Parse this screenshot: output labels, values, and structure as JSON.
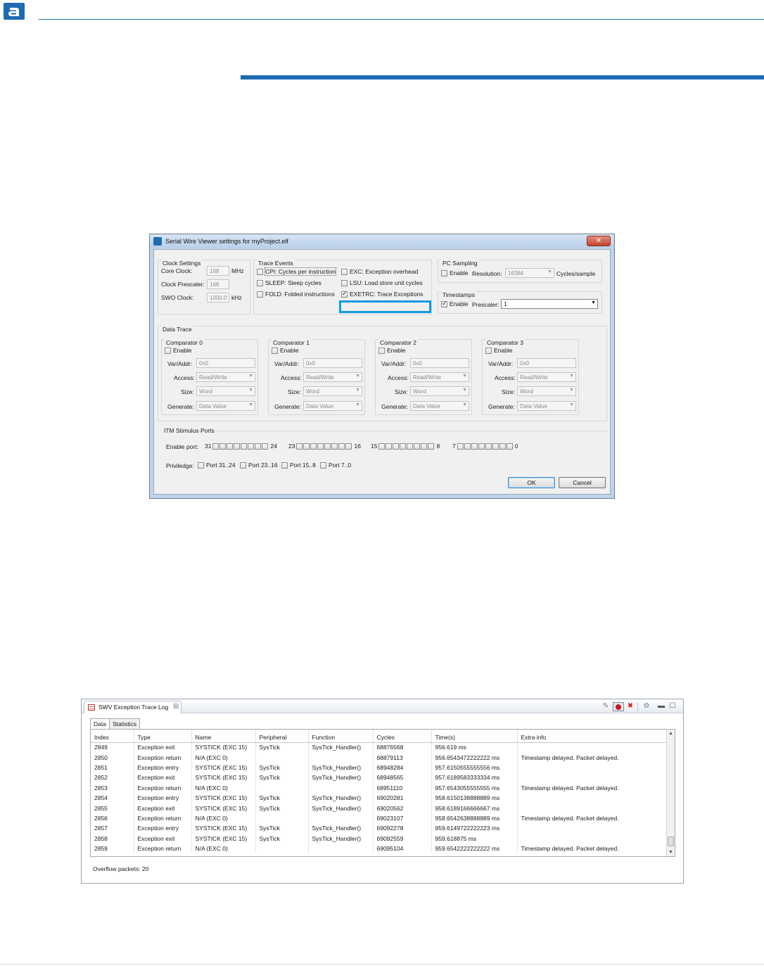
{
  "dialog": {
    "title": "Serial Wire Viewer settings for myProject.elf",
    "close_glyph": "✕",
    "clock": {
      "title": "Clock Settings",
      "core_clock_label": "Core Clock:",
      "core_clock_value": "168",
      "core_clock_unit": "MHz",
      "prescaler_label": "Clock Prescaler:",
      "prescaler_value": "168",
      "swo_label": "SWO Clock:",
      "swo_value": "1000.0",
      "swo_unit": "kHz"
    },
    "trace_events": {
      "title": "Trace Events",
      "items": [
        {
          "label": "CPI: Cycles per instruction",
          "checked": false
        },
        {
          "label": "EXC: Exception overhead",
          "checked": false
        },
        {
          "label": "SLEEP: Sleep cycles",
          "checked": false
        },
        {
          "label": "LSU: Load store unit cycles",
          "checked": false
        },
        {
          "label": "FOLD: Folded instructions",
          "checked": false
        },
        {
          "label": "EXETRC: Trace Exceptions",
          "checked": true
        }
      ]
    },
    "pc_sampling": {
      "title": "PC Sampling",
      "enable_label": "Enable",
      "enable_checked": false,
      "resolution_label": "Resolution:",
      "resolution_value": "16384",
      "unit": "Cycles/sample"
    },
    "timestamps": {
      "title": "Timestamps",
      "enable_label": "Enable",
      "enable_checked": true,
      "prescaler_label": "Prescaler:",
      "prescaler_value": "1"
    },
    "data_trace": {
      "title": "Data Trace",
      "comparators": [
        {
          "title": "Comparator 0",
          "enable": "Enable",
          "var_label": "Var/Addr:",
          "var_value": "0x0",
          "access_label": "Access:",
          "access_value": "Read/Write",
          "size_label": "Size:",
          "size_value": "Word",
          "generate_label": "Generate:",
          "generate_value": "Data Value"
        },
        {
          "title": "Comparator 1",
          "enable": "Enable",
          "var_label": "Var/Addr:",
          "var_value": "0x0",
          "access_label": "Access:",
          "access_value": "Read/Write",
          "size_label": "Size:",
          "size_value": "Word",
          "generate_label": "Generate:",
          "generate_value": "Data Value"
        },
        {
          "title": "Comparator 2",
          "enable": "Enable",
          "var_label": "Var/Addr:",
          "var_value": "0x0",
          "access_label": "Access:",
          "access_value": "Read/Write",
          "size_label": "Size:",
          "size_value": "Word",
          "generate_label": "Generate:",
          "generate_value": "Data Value"
        },
        {
          "title": "Comparator 3",
          "enable": "Enable",
          "var_label": "Var/Addr:",
          "var_value": "0x0",
          "access_label": "Access:",
          "access_value": "Read/Write",
          "size_label": "Size:",
          "size_value": "Word",
          "generate_label": "Generate:",
          "generate_value": "Data Value"
        }
      ]
    },
    "itm": {
      "title": "ITM Stimulus Ports",
      "enable_port_label": "Enable port:",
      "port_groups": [
        {
          "high": "31",
          "low": "24"
        },
        {
          "high": "23",
          "low": "16"
        },
        {
          "high": "15",
          "low": "8"
        },
        {
          "high": "7",
          "low": "0"
        }
      ],
      "privilege_label": "Priviledge:",
      "privileges": [
        "Port 31..24",
        "Port 23..16",
        "Port 15..8",
        "Port 7..0"
      ]
    },
    "ok_label": "OK",
    "cancel_label": "Cancel"
  },
  "trace_log": {
    "view_title": "SWV Exception Trace Log",
    "view_close": "☒",
    "tabs": [
      "Data",
      "Statistics"
    ],
    "columns": [
      "Index",
      "Type",
      "Name",
      "Peripheral",
      "Function",
      "Cycles",
      "Time(s)",
      "Extra info"
    ],
    "rows": [
      [
        "2849",
        "Exception exit",
        "SYSTICK (EXC 15)",
        "SysTick",
        "SysTick_Handler()",
        "68876568",
        "956.619 ms",
        ""
      ],
      [
        "2850",
        "Exception return",
        "N/A (EXC 0)",
        "",
        "",
        "68879113",
        "956.6543472222222 ms",
        "Timestamp delayed. Packet delayed."
      ],
      [
        "2851",
        "Exception entry",
        "SYSTICK (EXC 15)",
        "SysTick",
        "SysTick_Handler()",
        "68948284",
        "957.6150555555556 ms",
        ""
      ],
      [
        "2852",
        "Exception exit",
        "SYSTICK (EXC 15)",
        "SysTick",
        "SysTick_Handler()",
        "68948565",
        "957.6189583333334 ms",
        ""
      ],
      [
        "2853",
        "Exception return",
        "N/A (EXC 0)",
        "",
        "",
        "68951110",
        "957.6543055555555 ms",
        "Timestamp delayed. Packet delayed."
      ],
      [
        "2854",
        "Exception entry",
        "SYSTICK (EXC 15)",
        "SysTick",
        "SysTick_Handler()",
        "69020281",
        "958.6150138888889 ms",
        ""
      ],
      [
        "2855",
        "Exception exit",
        "SYSTICK (EXC 15)",
        "SysTick",
        "SysTick_Handler()",
        "69020562",
        "958.6189166666667 ms",
        ""
      ],
      [
        "2856",
        "Exception return",
        "N/A (EXC 0)",
        "",
        "",
        "69023107",
        "958.6542638888889 ms",
        "Timestamp delayed. Packet delayed."
      ],
      [
        "2857",
        "Exception entry",
        "SYSTICK (EXC 15)",
        "SysTick",
        "SysTick_Handler()",
        "69092278",
        "959.6149722222223 ms",
        ""
      ],
      [
        "2858",
        "Exception exit",
        "SYSTICK (EXC 15)",
        "SysTick",
        "SysTick_Handler()",
        "69092559",
        "959.618875 ms",
        ""
      ],
      [
        "2859",
        "Exception return",
        "N/A (EXC 0)",
        "",
        "",
        "69095104",
        "959.6542222222222 ms",
        "Timestamp delayed. Packet delayed."
      ]
    ],
    "overflow_text": "Overflow packets: 20"
  }
}
